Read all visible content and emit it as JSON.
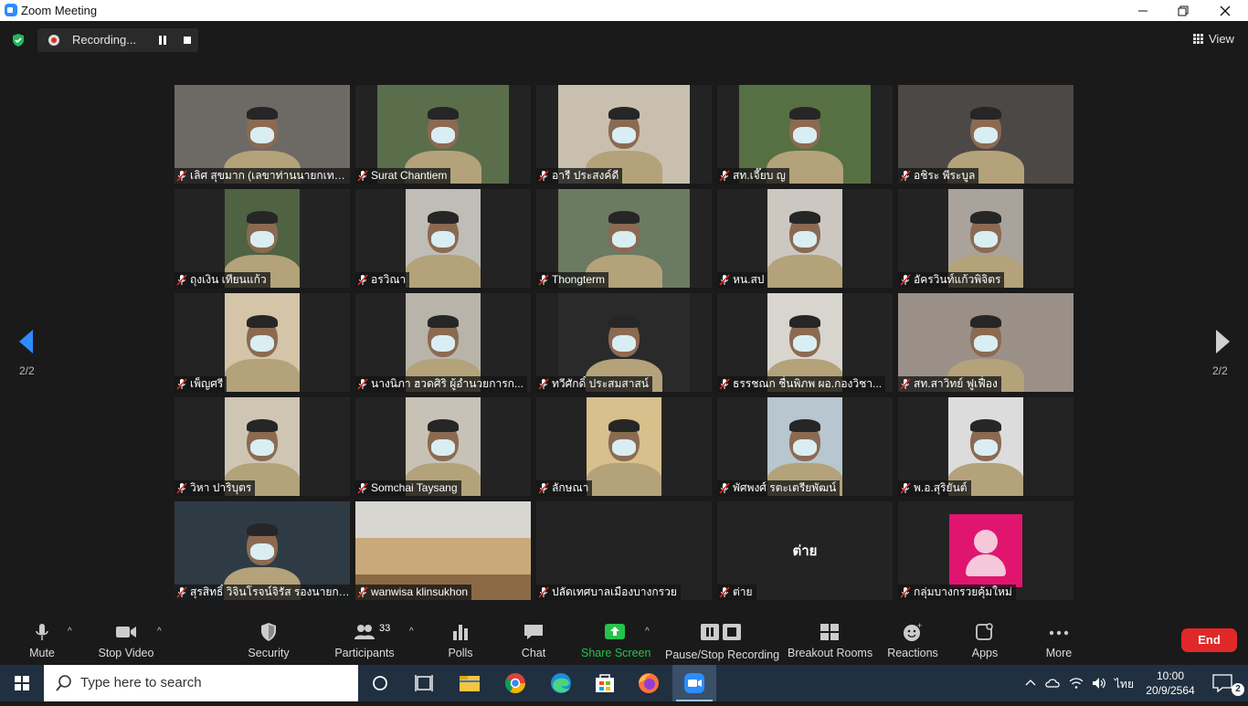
{
  "window": {
    "title": "Zoom Meeting",
    "controls": [
      "minimize",
      "restore",
      "close"
    ]
  },
  "meeting_header": {
    "recording_label": "Recording...",
    "view_label": "View"
  },
  "pagination": {
    "left_page": "2/2",
    "right_page": "2/2"
  },
  "participants_tiles": [
    {
      "name": "เลิศ สุขมาก (เลขาท่านนายกเทศ...",
      "muted": true
    },
    {
      "name": "Surat Chantiem",
      "muted": true
    },
    {
      "name": "อารี ประสงค์ดี",
      "muted": true
    },
    {
      "name": "สท.เจี๊ยบ ญ",
      "muted": true
    },
    {
      "name": "อชิระ พีระบูล",
      "muted": true
    },
    {
      "name": "ถุงเงิน เทียนแก้ว",
      "muted": true
    },
    {
      "name": "อรวิณา",
      "muted": true
    },
    {
      "name": "Thongterm",
      "muted": true
    },
    {
      "name": "หน.สป",
      "muted": true
    },
    {
      "name": "อัครวินท์แก้วพิจิตร",
      "muted": true
    },
    {
      "name": "เพ็ญศรี",
      "muted": true
    },
    {
      "name": "นางนิภา ฮวดศิริ ผู้อำนวยการก...",
      "muted": true
    },
    {
      "name": "ทวีศักดิ์ ประสมสาสน์",
      "muted": true
    },
    {
      "name": "ธรรชณก ชื่นพิภพ ผอ.กองวิชา...",
      "muted": true
    },
    {
      "name": "สท.สาวิทย์ ฟูเฟื่อง",
      "muted": true
    },
    {
      "name": "วิหา ปาริบุตร",
      "muted": true
    },
    {
      "name": "Somchai Taysang",
      "muted": true
    },
    {
      "name": "ลักษณา",
      "muted": true
    },
    {
      "name": "พัศพงศ์ รตะเตรียพัฒน์",
      "muted": true
    },
    {
      "name": "พ.อ.สุริยันต์",
      "muted": true
    },
    {
      "name": "สุรสิทธิ์ วิจินโรจน์จิรัส รองนายกเ...",
      "muted": true
    },
    {
      "name": "wanwisa klinsukhon",
      "muted": true
    },
    {
      "name": "ปลัดเทศบาลเมืองบางกรวย",
      "muted": true
    },
    {
      "name": "ต่าย",
      "muted": true,
      "center_text": "ต่าย"
    },
    {
      "name": "กลุ่มบางกรวยคุ้มใหม่",
      "muted": true
    }
  ],
  "toolbar": {
    "mute_label": "Mute",
    "stop_video_label": "Stop Video",
    "security_label": "Security",
    "participants_label": "Participants",
    "participants_count": "33",
    "polls_label": "Polls",
    "chat_label": "Chat",
    "share_screen_label": "Share Screen",
    "pause_stop_recording_label": "Pause/Stop Recording",
    "breakout_rooms_label": "Breakout Rooms",
    "reactions_label": "Reactions",
    "apps_label": "Apps",
    "more_label": "More",
    "end_label": "End"
  },
  "colors": {
    "share_green": "#27c24c",
    "end_red": "#e02828",
    "avatar_pink": "#e0156f",
    "taskbar": "#203040"
  },
  "taskbar": {
    "search_placeholder": "Type here to search",
    "apps": [
      "task-view-icon",
      "file-explorer-icon",
      "chrome-icon",
      "edge-icon",
      "store-icon",
      "firefox-icon",
      "zoom-icon"
    ],
    "language": "ไทย",
    "time": "10:00",
    "date": "20/9/2564",
    "notifications_count": "2"
  }
}
